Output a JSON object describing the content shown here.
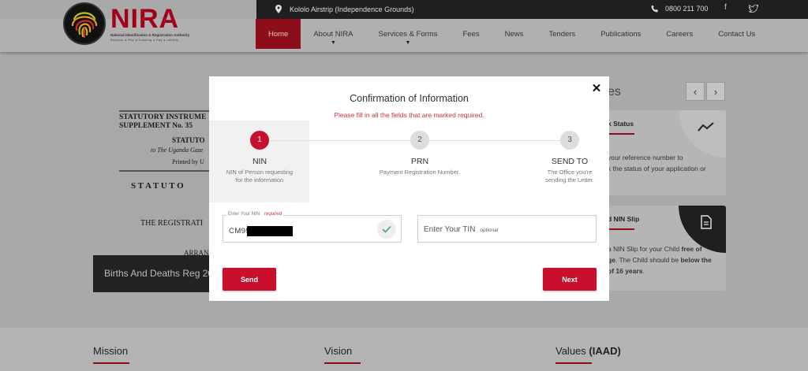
{
  "header": {
    "location": "Kololo Airstrip (Independence Grounds)",
    "phone": "0800 211 700",
    "logo": {
      "name": "NIRA",
      "subtitle": "National Identification & Registration Authority",
      "tagline": "Register  ●  Pay  ●  Dowsing  ●  Pay  ●  Identity"
    },
    "nav": [
      {
        "label": "Home",
        "active": true,
        "dropdown": false
      },
      {
        "label": "About NIRA",
        "active": false,
        "dropdown": true
      },
      {
        "label": "Services & Forms",
        "active": false,
        "dropdown": true
      },
      {
        "label": "Fees",
        "active": false,
        "dropdown": false
      },
      {
        "label": "News",
        "active": false,
        "dropdown": false
      },
      {
        "label": "Tenders",
        "active": false,
        "dropdown": false
      },
      {
        "label": "Publications",
        "active": false,
        "dropdown": false
      },
      {
        "label": "Careers",
        "active": false,
        "dropdown": false
      },
      {
        "label": "Contact Us",
        "active": false,
        "dropdown": false
      }
    ]
  },
  "background": {
    "document": {
      "line1": "STATUTORY INSTRUME",
      "line2": "SUPPLEMENT No. 35",
      "line3": "STATUTO",
      "line4": "to The Uganda Gaze",
      "line5": "Printed by U",
      "line6": "S T A T U T O",
      "line7": "THE REGISTRATI",
      "line8": "ARRAN",
      "caption": "Births And Deaths Reg 20"
    },
    "news_heading": "es",
    "card1": {
      "title": "k Status",
      "body1": "your reference number to",
      "body2": "k the status of your application or"
    },
    "card2": {
      "title": "d NIN Slip",
      "line1_pre": "a NIN Slip for your Child ",
      "line1_bold": "free of",
      "line2_bold": "ge",
      "line2_rest": ". The Child should be ",
      "line2_bold2": "below the",
      "line3_bold": "of 16 years",
      "line3_rest": "."
    },
    "footer": {
      "mission": "Mission",
      "vision": "Vision",
      "values": "Values ",
      "values_bold": "(IAAD)"
    }
  },
  "modal": {
    "title": "Confirmation of Information",
    "subtitle": "Please fill in all the fields that are marked required.",
    "steps": [
      {
        "num": "1",
        "label": "NIN",
        "desc1": "NIN of Person requesting",
        "desc2": "for the information",
        "active": true
      },
      {
        "num": "2",
        "label": "PRN",
        "desc1": "Payment Registration Number.",
        "desc2": "",
        "active": false
      },
      {
        "num": "3",
        "label": "SEND TO",
        "desc1": "The Office you're",
        "desc2": "sending the Letter.",
        "active": false
      }
    ],
    "nin_field": {
      "label": "Enter Your NIN",
      "required": "required",
      "value": "CM95"
    },
    "tin_field": {
      "placeholder": "Enter Your TIN",
      "optional": "optional"
    },
    "send_label": "Send",
    "next_label": "Next",
    "close": "✕"
  },
  "colors": {
    "brand_red": "#c8102e",
    "dark_red": "#8e0d1a"
  }
}
